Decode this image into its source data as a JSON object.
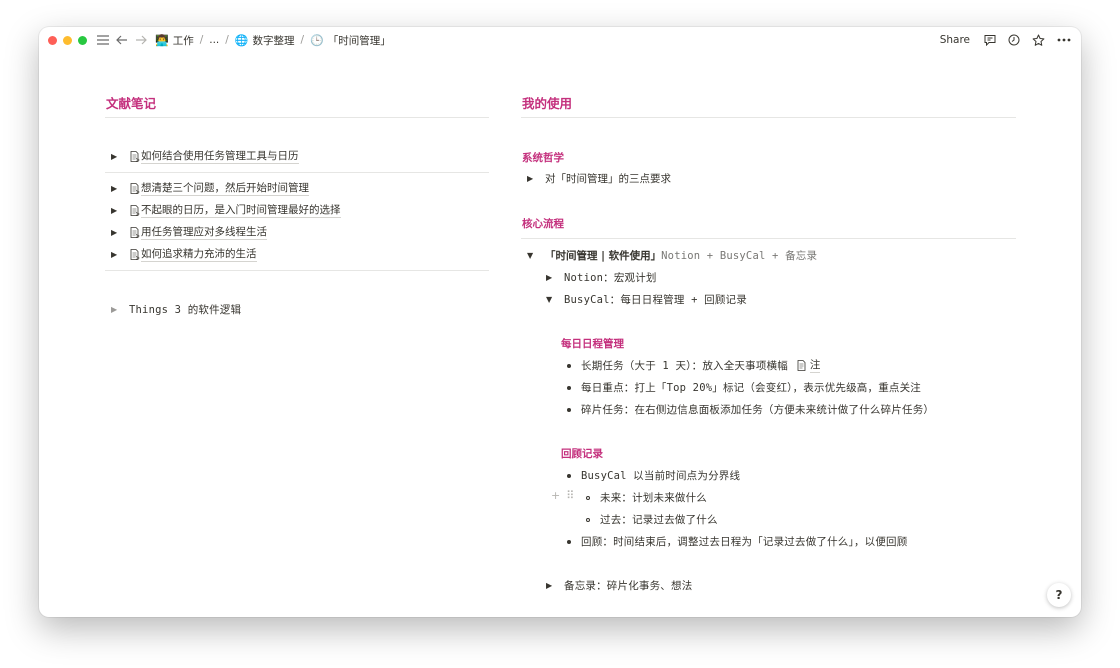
{
  "titlebar": {
    "breadcrumb": [
      {
        "icon": "person-emoji",
        "glyph": "👨‍💻",
        "label": "工作"
      },
      {
        "label": "..."
      },
      {
        "icon": "globe-emoji",
        "glyph": "🌐",
        "label": "数字整理"
      },
      {
        "icon": "clock-emoji",
        "glyph": "🕒",
        "label": "「时间管理」"
      }
    ],
    "separator": "/",
    "share_label": "Share"
  },
  "left": {
    "heading": "文献笔记",
    "first_item": "如何结合使用任务管理工具与日历",
    "items": [
      "想清楚三个问题，然后开始时间管理",
      "不起眼的日历，是入门时间管理最好的选择",
      "用任务管理应对多线程生活",
      "如何追求精力充沛的生活"
    ],
    "things_item": "Things 3 的软件逻辑"
  },
  "right": {
    "heading": "我的使用",
    "philosophy": {
      "title": "系统哲学",
      "item": "对「时间管理」的三点要求"
    },
    "flow": {
      "title": "核心流程",
      "toggle_bold": "「时间管理 | 软件使用」",
      "toggle_rest": "Notion + BusyCal + 备忘录",
      "notion_item": "Notion：宏观计划",
      "busycal_item": "BusyCal：每日日程管理 + 回顾记录",
      "daily": {
        "title": "每日日程管理",
        "items": [
          "长期任务（大于 1 天）：放入全天事项横幅",
          "每日重点：打上「Top 20%」标记（会变红），表示优先级高，重点关注",
          "碎片任务：在右侧边信息面板添加任务（方便未来统计做了什么碎片任务）"
        ],
        "note_link": "注"
      },
      "review": {
        "title": "回顾记录",
        "item1": "BusyCal 以当前时间点为分界线",
        "sub_items": [
          "未来：计划未来做什么",
          "过去：记录过去做了什么"
        ],
        "item2": "回顾：时间结束后，调整过去日程为「记录过去做了什么」，以便回顾"
      },
      "memo_item": "备忘录：碎片化事务、想法"
    }
  },
  "help_label": "?",
  "colors": {
    "accent": "#c4307d",
    "text": "#37352f",
    "divider": "#e6e6e4"
  }
}
